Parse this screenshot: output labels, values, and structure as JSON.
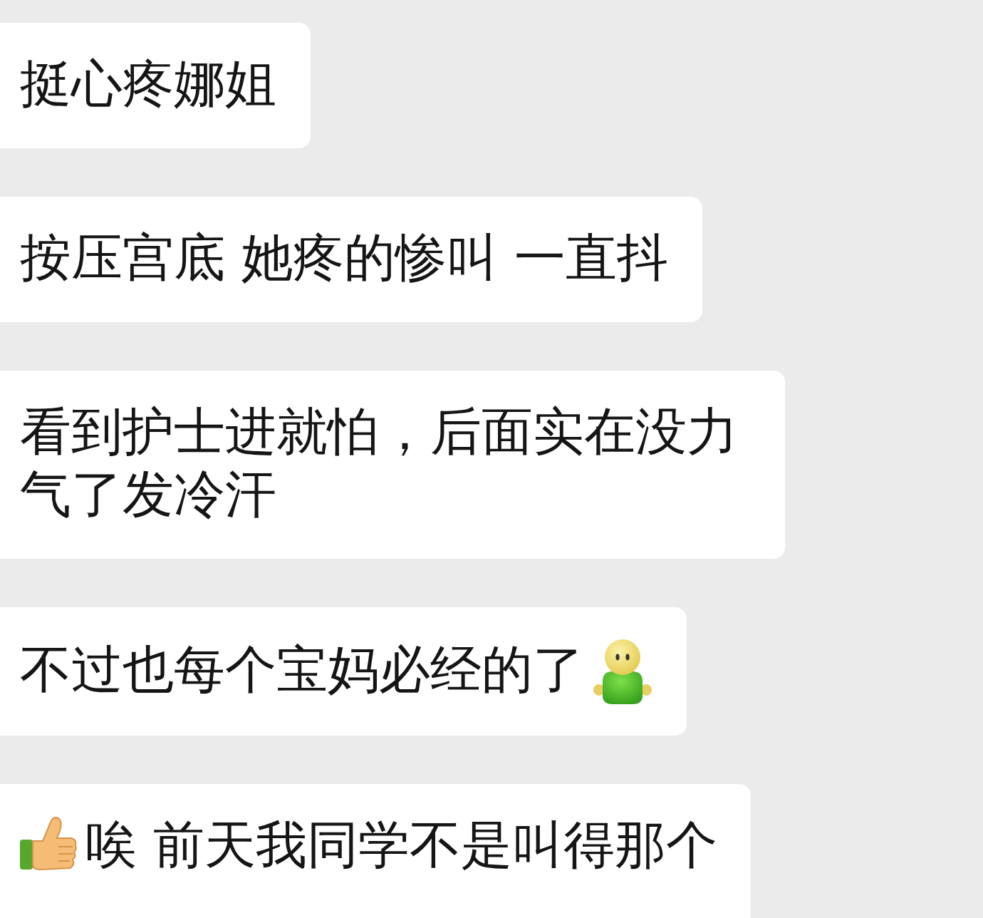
{
  "messages": [
    {
      "kind": "plain",
      "text": "挺心疼娜姐"
    },
    {
      "kind": "plain",
      "text": "按压宫底 她疼的惨叫 一直抖"
    },
    {
      "kind": "plain",
      "text": "看到护士进就怕，后面实在没力气了发冷汗"
    },
    {
      "kind": "emoji_end",
      "text": "不过也每个宝妈必经的了"
    },
    {
      "kind": "emoji_start",
      "text": "唉 前天我同学不是叫得那个"
    }
  ]
}
